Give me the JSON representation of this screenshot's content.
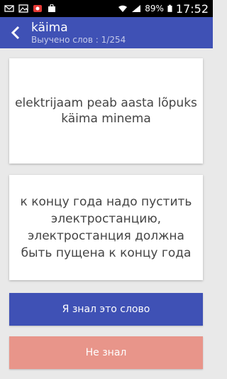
{
  "status_bar": {
    "battery": "89%",
    "time": "17:52"
  },
  "header": {
    "title": "käima",
    "subtitle": "Выучено слов : 1/254"
  },
  "card": {
    "phrase": "elektrijaam peab aasta lõpuks käima minema",
    "translation": "к концу года надо пустить электростанцию, электростанция должна быть пущена к концу года"
  },
  "buttons": {
    "known_label": "Я знал это слово",
    "unknown_label": "Не знал"
  },
  "colors": {
    "primary": "#3f51b5",
    "unknown": "#e8958a",
    "background": "#e9e9e9"
  }
}
